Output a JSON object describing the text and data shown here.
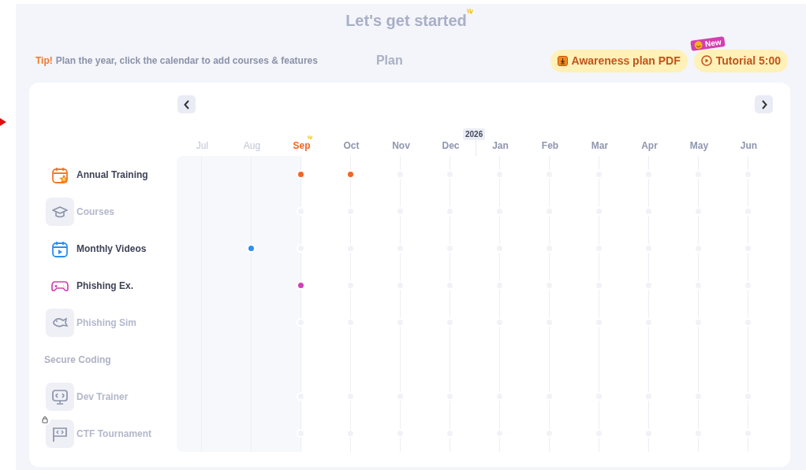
{
  "header": {
    "title": "Let's get started",
    "tip_label": "Tip!",
    "tip_text": "Plan the year, click the calendar to add courses & features",
    "plan_label": "Plan"
  },
  "buttons": [
    {
      "kind": "pdf",
      "label": "Awareness plan PDF"
    },
    {
      "kind": "video",
      "label": "Tutorial 5:00",
      "badge": "New"
    }
  ],
  "months": [
    {
      "label": "Jul",
      "past": true,
      "current": false
    },
    {
      "label": "Aug",
      "past": true,
      "current": false
    },
    {
      "label": "Sep",
      "past": false,
      "current": true
    },
    {
      "label": "Oct",
      "past": false,
      "current": false
    },
    {
      "label": "Nov",
      "past": false,
      "current": false
    },
    {
      "label": "Dec",
      "past": false,
      "current": false
    },
    {
      "label": "Jan",
      "past": false,
      "current": false,
      "year": "2026"
    },
    {
      "label": "Feb",
      "past": false,
      "current": false
    },
    {
      "label": "Mar",
      "past": false,
      "current": false
    },
    {
      "label": "Apr",
      "past": false,
      "current": false
    },
    {
      "label": "May",
      "past": false,
      "current": false
    },
    {
      "label": "Jun",
      "past": false,
      "current": false
    }
  ],
  "rows": [
    {
      "kind": "feature",
      "label": "Annual Training",
      "enabled": true,
      "locked": false,
      "slots": [
        {
          "filled": false
        },
        {
          "filled": false
        },
        {
          "filled": true,
          "color": "#f26522"
        },
        {
          "filled": true,
          "color": "#f26522"
        },
        {
          "filled": false
        },
        {
          "filled": false
        },
        {
          "filled": false
        },
        {
          "filled": false
        },
        {
          "filled": false
        },
        {
          "filled": false
        },
        {
          "filled": false
        },
        {
          "filled": false
        }
      ]
    },
    {
      "kind": "feature",
      "label": "Courses",
      "enabled": false,
      "locked": false,
      "slots": [
        {
          "filled": false
        },
        {
          "filled": false
        },
        {
          "filled": false
        },
        {
          "filled": false
        },
        {
          "filled": false
        },
        {
          "filled": false
        },
        {
          "filled": false
        },
        {
          "filled": false
        },
        {
          "filled": false
        },
        {
          "filled": false
        },
        {
          "filled": false
        },
        {
          "filled": false
        }
      ]
    },
    {
      "kind": "feature",
      "label": "Monthly Videos",
      "enabled": true,
      "locked": false,
      "slots": [
        {
          "filled": false
        },
        {
          "filled": true,
          "color": "#2b8ff0"
        },
        {
          "filled": false
        },
        {
          "filled": false
        },
        {
          "filled": false
        },
        {
          "filled": false
        },
        {
          "filled": false
        },
        {
          "filled": false
        },
        {
          "filled": false
        },
        {
          "filled": false
        },
        {
          "filled": false
        },
        {
          "filled": false
        }
      ]
    },
    {
      "kind": "feature",
      "label": "Phishing Ex.",
      "enabled": true,
      "locked": false,
      "slots": [
        {
          "filled": false
        },
        {
          "filled": false
        },
        {
          "filled": true,
          "color": "#d040b8"
        },
        {
          "filled": false
        },
        {
          "filled": false
        },
        {
          "filled": false
        },
        {
          "filled": false
        },
        {
          "filled": false
        },
        {
          "filled": false
        },
        {
          "filled": false
        },
        {
          "filled": false
        },
        {
          "filled": false
        }
      ]
    },
    {
      "kind": "feature",
      "label": "Phishing Sim",
      "enabled": false,
      "locked": false,
      "slots": [
        {
          "filled": false
        },
        {
          "filled": false
        },
        {
          "filled": false
        },
        {
          "filled": false
        },
        {
          "filled": false
        },
        {
          "filled": false
        },
        {
          "filled": false
        },
        {
          "filled": false
        },
        {
          "filled": false
        },
        {
          "filled": false
        },
        {
          "filled": false
        },
        {
          "filled": false
        }
      ]
    },
    {
      "kind": "section",
      "label": "Secure Coding"
    },
    {
      "kind": "feature",
      "label": "Dev Trainer",
      "enabled": false,
      "locked": false,
      "slots": [
        {
          "filled": false
        },
        {
          "filled": false
        },
        {
          "filled": false
        },
        {
          "filled": false
        },
        {
          "filled": false
        },
        {
          "filled": false
        },
        {
          "filled": false
        },
        {
          "filled": false
        },
        {
          "filled": false
        },
        {
          "filled": false
        },
        {
          "filled": false
        },
        {
          "filled": false
        }
      ]
    },
    {
      "kind": "feature",
      "label": "CTF Tournament",
      "enabled": false,
      "locked": true,
      "slots": [
        {
          "filled": false
        },
        {
          "filled": false
        },
        {
          "filled": false
        },
        {
          "filled": false
        },
        {
          "filled": false
        },
        {
          "filled": false
        },
        {
          "filled": false
        },
        {
          "filled": false
        },
        {
          "filled": false
        },
        {
          "filled": false
        },
        {
          "filled": false
        },
        {
          "filled": false
        }
      ]
    }
  ]
}
